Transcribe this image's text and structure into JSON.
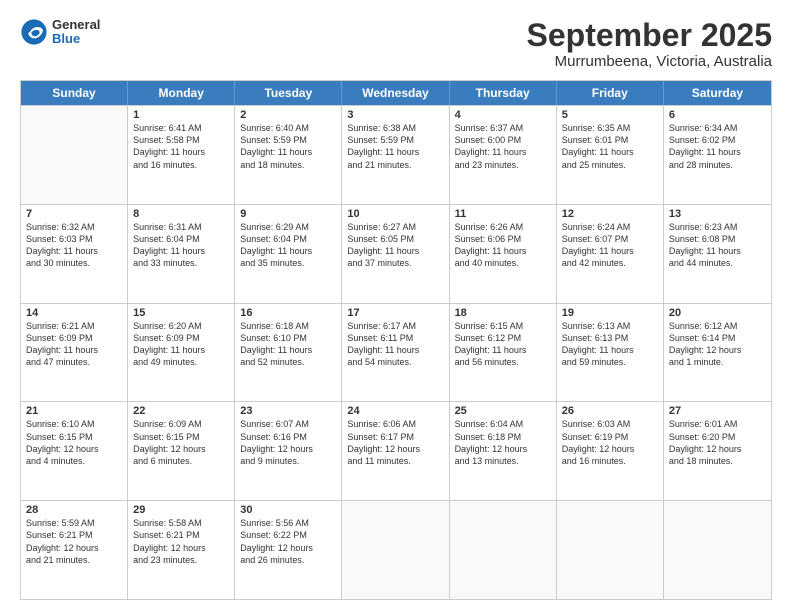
{
  "header": {
    "logo_general": "General",
    "logo_blue": "Blue",
    "title": "September 2025",
    "subtitle": "Murrumbeena, Victoria, Australia"
  },
  "weekdays": [
    "Sunday",
    "Monday",
    "Tuesday",
    "Wednesday",
    "Thursday",
    "Friday",
    "Saturday"
  ],
  "rows": [
    [
      {
        "day": "",
        "info": ""
      },
      {
        "day": "1",
        "info": "Sunrise: 6:41 AM\nSunset: 5:58 PM\nDaylight: 11 hours\nand 16 minutes."
      },
      {
        "day": "2",
        "info": "Sunrise: 6:40 AM\nSunset: 5:59 PM\nDaylight: 11 hours\nand 18 minutes."
      },
      {
        "day": "3",
        "info": "Sunrise: 6:38 AM\nSunset: 5:59 PM\nDaylight: 11 hours\nand 21 minutes."
      },
      {
        "day": "4",
        "info": "Sunrise: 6:37 AM\nSunset: 6:00 PM\nDaylight: 11 hours\nand 23 minutes."
      },
      {
        "day": "5",
        "info": "Sunrise: 6:35 AM\nSunset: 6:01 PM\nDaylight: 11 hours\nand 25 minutes."
      },
      {
        "day": "6",
        "info": "Sunrise: 6:34 AM\nSunset: 6:02 PM\nDaylight: 11 hours\nand 28 minutes."
      }
    ],
    [
      {
        "day": "7",
        "info": "Sunrise: 6:32 AM\nSunset: 6:03 PM\nDaylight: 11 hours\nand 30 minutes."
      },
      {
        "day": "8",
        "info": "Sunrise: 6:31 AM\nSunset: 6:04 PM\nDaylight: 11 hours\nand 33 minutes."
      },
      {
        "day": "9",
        "info": "Sunrise: 6:29 AM\nSunset: 6:04 PM\nDaylight: 11 hours\nand 35 minutes."
      },
      {
        "day": "10",
        "info": "Sunrise: 6:27 AM\nSunset: 6:05 PM\nDaylight: 11 hours\nand 37 minutes."
      },
      {
        "day": "11",
        "info": "Sunrise: 6:26 AM\nSunset: 6:06 PM\nDaylight: 11 hours\nand 40 minutes."
      },
      {
        "day": "12",
        "info": "Sunrise: 6:24 AM\nSunset: 6:07 PM\nDaylight: 11 hours\nand 42 minutes."
      },
      {
        "day": "13",
        "info": "Sunrise: 6:23 AM\nSunset: 6:08 PM\nDaylight: 11 hours\nand 44 minutes."
      }
    ],
    [
      {
        "day": "14",
        "info": "Sunrise: 6:21 AM\nSunset: 6:09 PM\nDaylight: 11 hours\nand 47 minutes."
      },
      {
        "day": "15",
        "info": "Sunrise: 6:20 AM\nSunset: 6:09 PM\nDaylight: 11 hours\nand 49 minutes."
      },
      {
        "day": "16",
        "info": "Sunrise: 6:18 AM\nSunset: 6:10 PM\nDaylight: 11 hours\nand 52 minutes."
      },
      {
        "day": "17",
        "info": "Sunrise: 6:17 AM\nSunset: 6:11 PM\nDaylight: 11 hours\nand 54 minutes."
      },
      {
        "day": "18",
        "info": "Sunrise: 6:15 AM\nSunset: 6:12 PM\nDaylight: 11 hours\nand 56 minutes."
      },
      {
        "day": "19",
        "info": "Sunrise: 6:13 AM\nSunset: 6:13 PM\nDaylight: 11 hours\nand 59 minutes."
      },
      {
        "day": "20",
        "info": "Sunrise: 6:12 AM\nSunset: 6:14 PM\nDaylight: 12 hours\nand 1 minute."
      }
    ],
    [
      {
        "day": "21",
        "info": "Sunrise: 6:10 AM\nSunset: 6:15 PM\nDaylight: 12 hours\nand 4 minutes."
      },
      {
        "day": "22",
        "info": "Sunrise: 6:09 AM\nSunset: 6:15 PM\nDaylight: 12 hours\nand 6 minutes."
      },
      {
        "day": "23",
        "info": "Sunrise: 6:07 AM\nSunset: 6:16 PM\nDaylight: 12 hours\nand 9 minutes."
      },
      {
        "day": "24",
        "info": "Sunrise: 6:06 AM\nSunset: 6:17 PM\nDaylight: 12 hours\nand 11 minutes."
      },
      {
        "day": "25",
        "info": "Sunrise: 6:04 AM\nSunset: 6:18 PM\nDaylight: 12 hours\nand 13 minutes."
      },
      {
        "day": "26",
        "info": "Sunrise: 6:03 AM\nSunset: 6:19 PM\nDaylight: 12 hours\nand 16 minutes."
      },
      {
        "day": "27",
        "info": "Sunrise: 6:01 AM\nSunset: 6:20 PM\nDaylight: 12 hours\nand 18 minutes."
      }
    ],
    [
      {
        "day": "28",
        "info": "Sunrise: 5:59 AM\nSunset: 6:21 PM\nDaylight: 12 hours\nand 21 minutes."
      },
      {
        "day": "29",
        "info": "Sunrise: 5:58 AM\nSunset: 6:21 PM\nDaylight: 12 hours\nand 23 minutes."
      },
      {
        "day": "30",
        "info": "Sunrise: 5:56 AM\nSunset: 6:22 PM\nDaylight: 12 hours\nand 26 minutes."
      },
      {
        "day": "",
        "info": ""
      },
      {
        "day": "",
        "info": ""
      },
      {
        "day": "",
        "info": ""
      },
      {
        "day": "",
        "info": ""
      }
    ]
  ]
}
